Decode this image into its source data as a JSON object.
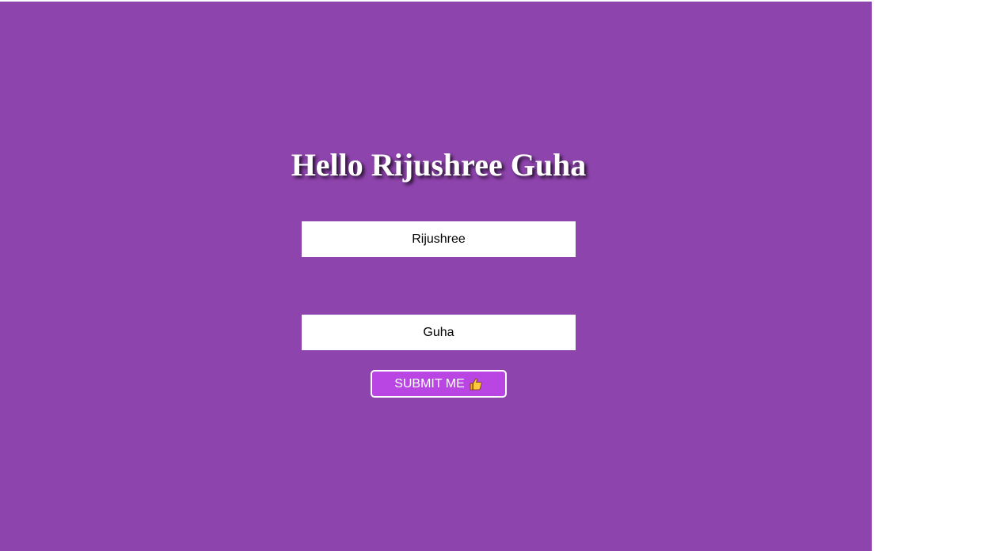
{
  "page": {
    "background_color": "#8e44ad",
    "title": "Hello Rijushree Guha"
  },
  "form": {
    "first_name_value": "Rijushree",
    "last_name_value": "Guha",
    "submit_label": "SUBMIT ME",
    "submit_icon": "thumbs-up-icon",
    "submit_color": "#b946e2"
  }
}
